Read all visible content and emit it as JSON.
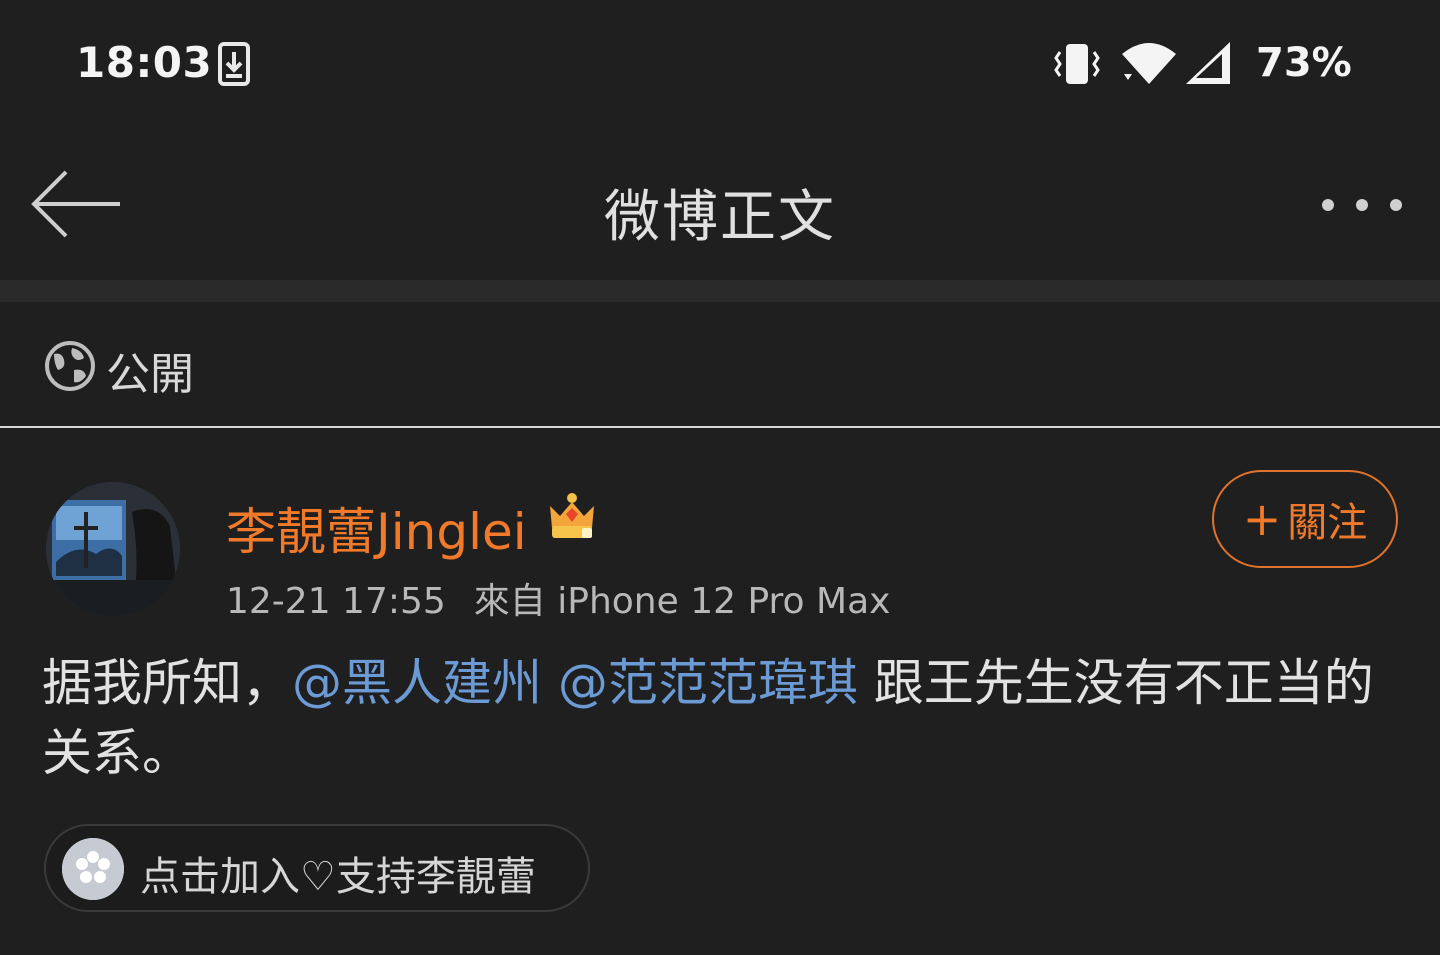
{
  "status_bar": {
    "time": "18:03",
    "battery": "73%",
    "icons": [
      "download-icon",
      "vibrate-icon",
      "wifi-icon",
      "signal-icon"
    ]
  },
  "nav": {
    "title": "微博正文",
    "back_icon": "back-arrow-icon",
    "more_icon": "more-dots-icon"
  },
  "privacy": {
    "label": "公開",
    "icon": "globe-icon"
  },
  "post": {
    "author": "李靚蕾Jingle",
    "author_suffix": "i",
    "time": "12-21 17:55",
    "source": "來自 iPhone 12 Pro Max",
    "follow_label": "關注",
    "follow_plus": "+",
    "text_before": "据我所知，",
    "mention_1": "@黑人建州",
    "mention_2": "@范范范瑋琪",
    "text_after": " 跟王先生没有不正当的关系。",
    "support_label": "点击加入♡支持李靚蕾"
  },
  "colors": {
    "background": "#1f1f1f",
    "accent": "#f07a2a",
    "mention": "#6b9ad4"
  }
}
